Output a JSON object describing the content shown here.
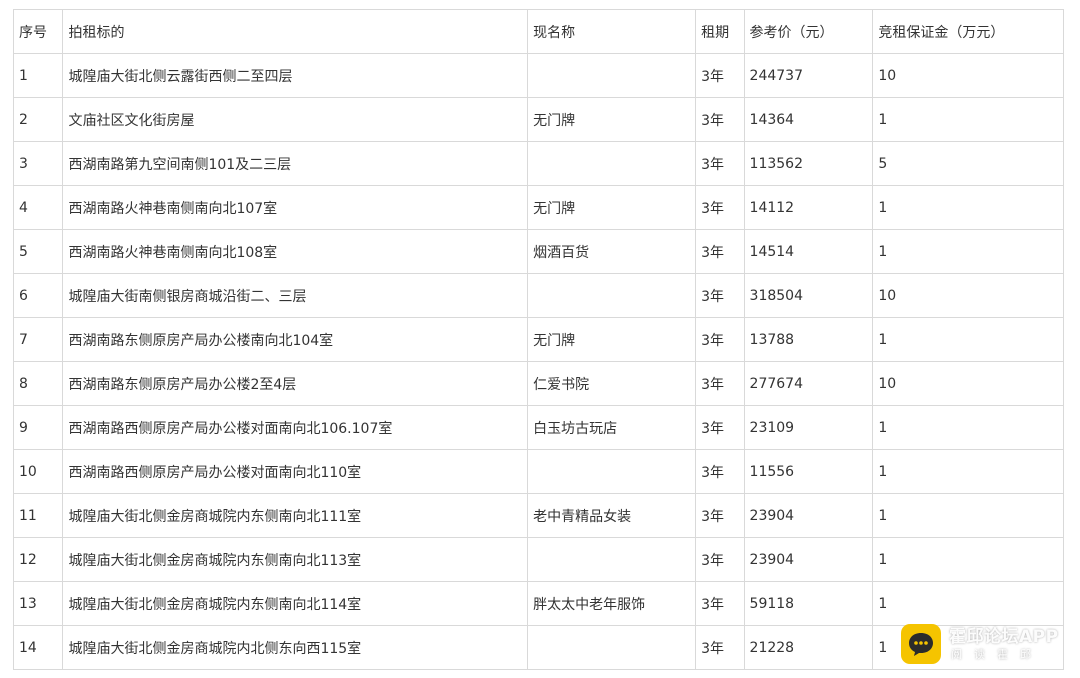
{
  "table": {
    "headers": [
      "序号",
      "拍租标的",
      "现名称",
      "租期",
      "参考价（元）",
      "竞租保证金（万元）"
    ],
    "rows": [
      [
        "1",
        "城隍庙大街北侧云露街西侧二至四层",
        "",
        "3年",
        "244737",
        "10"
      ],
      [
        "2",
        "文庙社区文化街房屋",
        "无门牌",
        "3年",
        "14364",
        "1"
      ],
      [
        "3",
        "西湖南路第九空间南侧101及二三层",
        "",
        "3年",
        "113562",
        "5"
      ],
      [
        "4",
        "西湖南路火神巷南侧南向北107室",
        "无门牌",
        "3年",
        "14112",
        "1"
      ],
      [
        "5",
        "西湖南路火神巷南侧南向北108室",
        "烟酒百货",
        "3年",
        "14514",
        "1"
      ],
      [
        "6",
        "城隍庙大街南侧银房商城沿街二、三层",
        "",
        "3年",
        "318504",
        "10"
      ],
      [
        "7",
        "西湖南路东侧原房产局办公楼南向北104室",
        "无门牌",
        "3年",
        "13788",
        "1"
      ],
      [
        "8",
        "西湖南路东侧原房产局办公楼2至4层",
        "仁爱书院",
        "3年",
        "277674",
        "10"
      ],
      [
        "9",
        "西湖南路西侧原房产局办公楼对面南向北106.107室",
        "白玉坊古玩店",
        "3年",
        "23109",
        "1"
      ],
      [
        "10",
        "西湖南路西侧原房产局办公楼对面南向北110室",
        "",
        "3年",
        "11556",
        "1"
      ],
      [
        "11",
        "城隍庙大街北侧金房商城院内东侧南向北111室",
        "老中青精品女装",
        "3年",
        "23904",
        "1"
      ],
      [
        "12",
        "城隍庙大街北侧金房商城院内东侧南向北113室",
        "",
        "3年",
        "23904",
        "1"
      ],
      [
        "13",
        "城隍庙大街北侧金房商城院内东侧南向北114室",
        "胖太太中老年服饰",
        "3年",
        "59118",
        "1"
      ],
      [
        "14",
        "城隍庙大街北侧金房商城院内北侧东向西115室",
        "",
        "3年",
        "21228",
        "1"
      ]
    ]
  },
  "watermark": {
    "title": "霍邱论坛APP",
    "subtitle": "阅读霍邱",
    "logo_icon": "chat-bubble-icon",
    "logo_color": "#f5c400"
  }
}
